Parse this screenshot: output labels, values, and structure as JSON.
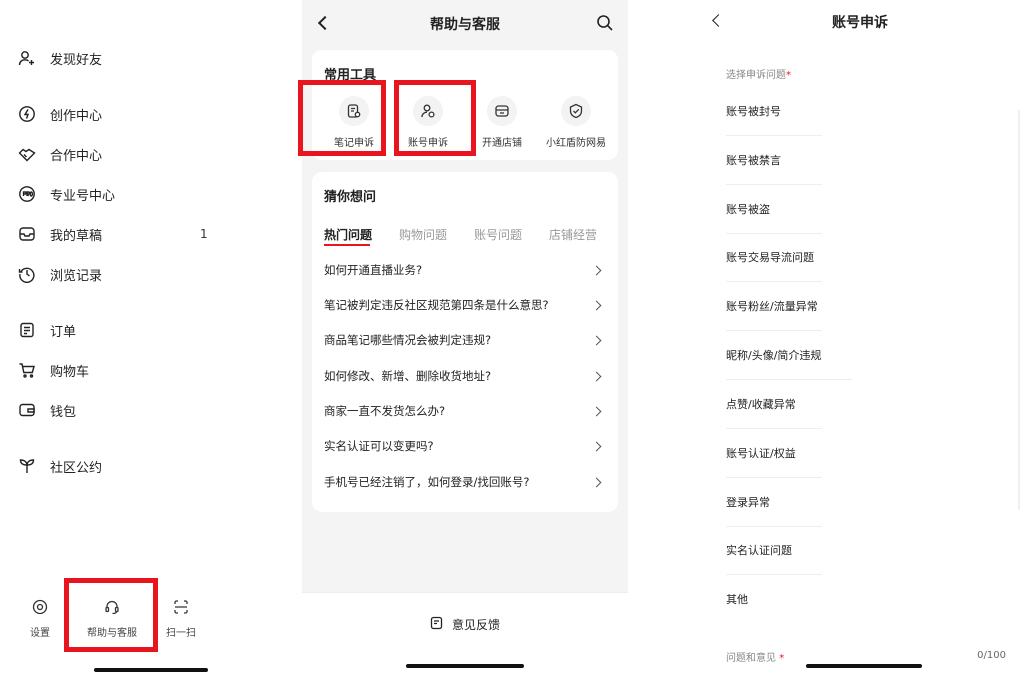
{
  "drawer": {
    "items": [
      {
        "label": "发现好友",
        "icon": "add-friend-icon"
      },
      {
        "label": "创作中心",
        "icon": "lightning-icon"
      },
      {
        "label": "合作中心",
        "icon": "handshake-icon"
      },
      {
        "label": "专业号中心",
        "icon": "pro-badge-icon"
      },
      {
        "label": "我的草稿",
        "icon": "draft-box-icon",
        "badge": "1"
      },
      {
        "label": "浏览记录",
        "icon": "history-clock-icon"
      },
      {
        "label": "订单",
        "icon": "order-list-icon"
      },
      {
        "label": "购物车",
        "icon": "shopping-cart-icon"
      },
      {
        "label": "钱包",
        "icon": "wallet-icon"
      },
      {
        "label": "社区公约",
        "icon": "sprout-icon"
      }
    ],
    "bottom": [
      {
        "label": "设置",
        "icon": "settings-icon"
      },
      {
        "label": "帮助与客服",
        "icon": "headset-icon"
      },
      {
        "label": "扫一扫",
        "icon": "scan-icon"
      }
    ]
  },
  "help": {
    "title": "帮助与客服",
    "tools_title": "常用工具",
    "tools": [
      {
        "label": "笔记申诉",
        "icon": "note-appeal-icon"
      },
      {
        "label": "账号申诉",
        "icon": "account-appeal-icon"
      },
      {
        "label": "开通店铺",
        "icon": "open-store-icon"
      },
      {
        "label": "小红盾防网易",
        "icon": "shield-check-icon"
      }
    ],
    "faq_title": "猜你想问",
    "tabs": [
      "热门问题",
      "购物问题",
      "账号问题",
      "店铺经营"
    ],
    "questions": [
      "如何开通直播业务?",
      "笔记被判定违反社区规范第四条是什么意思?",
      "商品笔记哪些情况会被判定违规?",
      "如何修改、新增、删除收货地址?",
      "商家一直不发货怎么办?",
      "实名认证可以变更吗?",
      "手机号已经注销了，如何登录/找回账号?"
    ],
    "feedback_label": "意见反馈"
  },
  "appeal": {
    "title": "账号申诉",
    "select_label": "选择申诉问题",
    "required_mark": "*",
    "reasons": [
      "账号被封号",
      "账号被禁言",
      "账号被盗",
      "账号交易导流问题",
      "账号粉丝/流量异常",
      "昵称/头像/简介违规",
      "点赞/收藏异常",
      "账号认证/权益",
      "登录异常",
      "实名认证问题",
      "其他"
    ],
    "opinion_label": "问题和意见",
    "counter": "0/100"
  },
  "colors": {
    "accent": "#e8141e",
    "text": "#222222",
    "muted": "#999999"
  }
}
